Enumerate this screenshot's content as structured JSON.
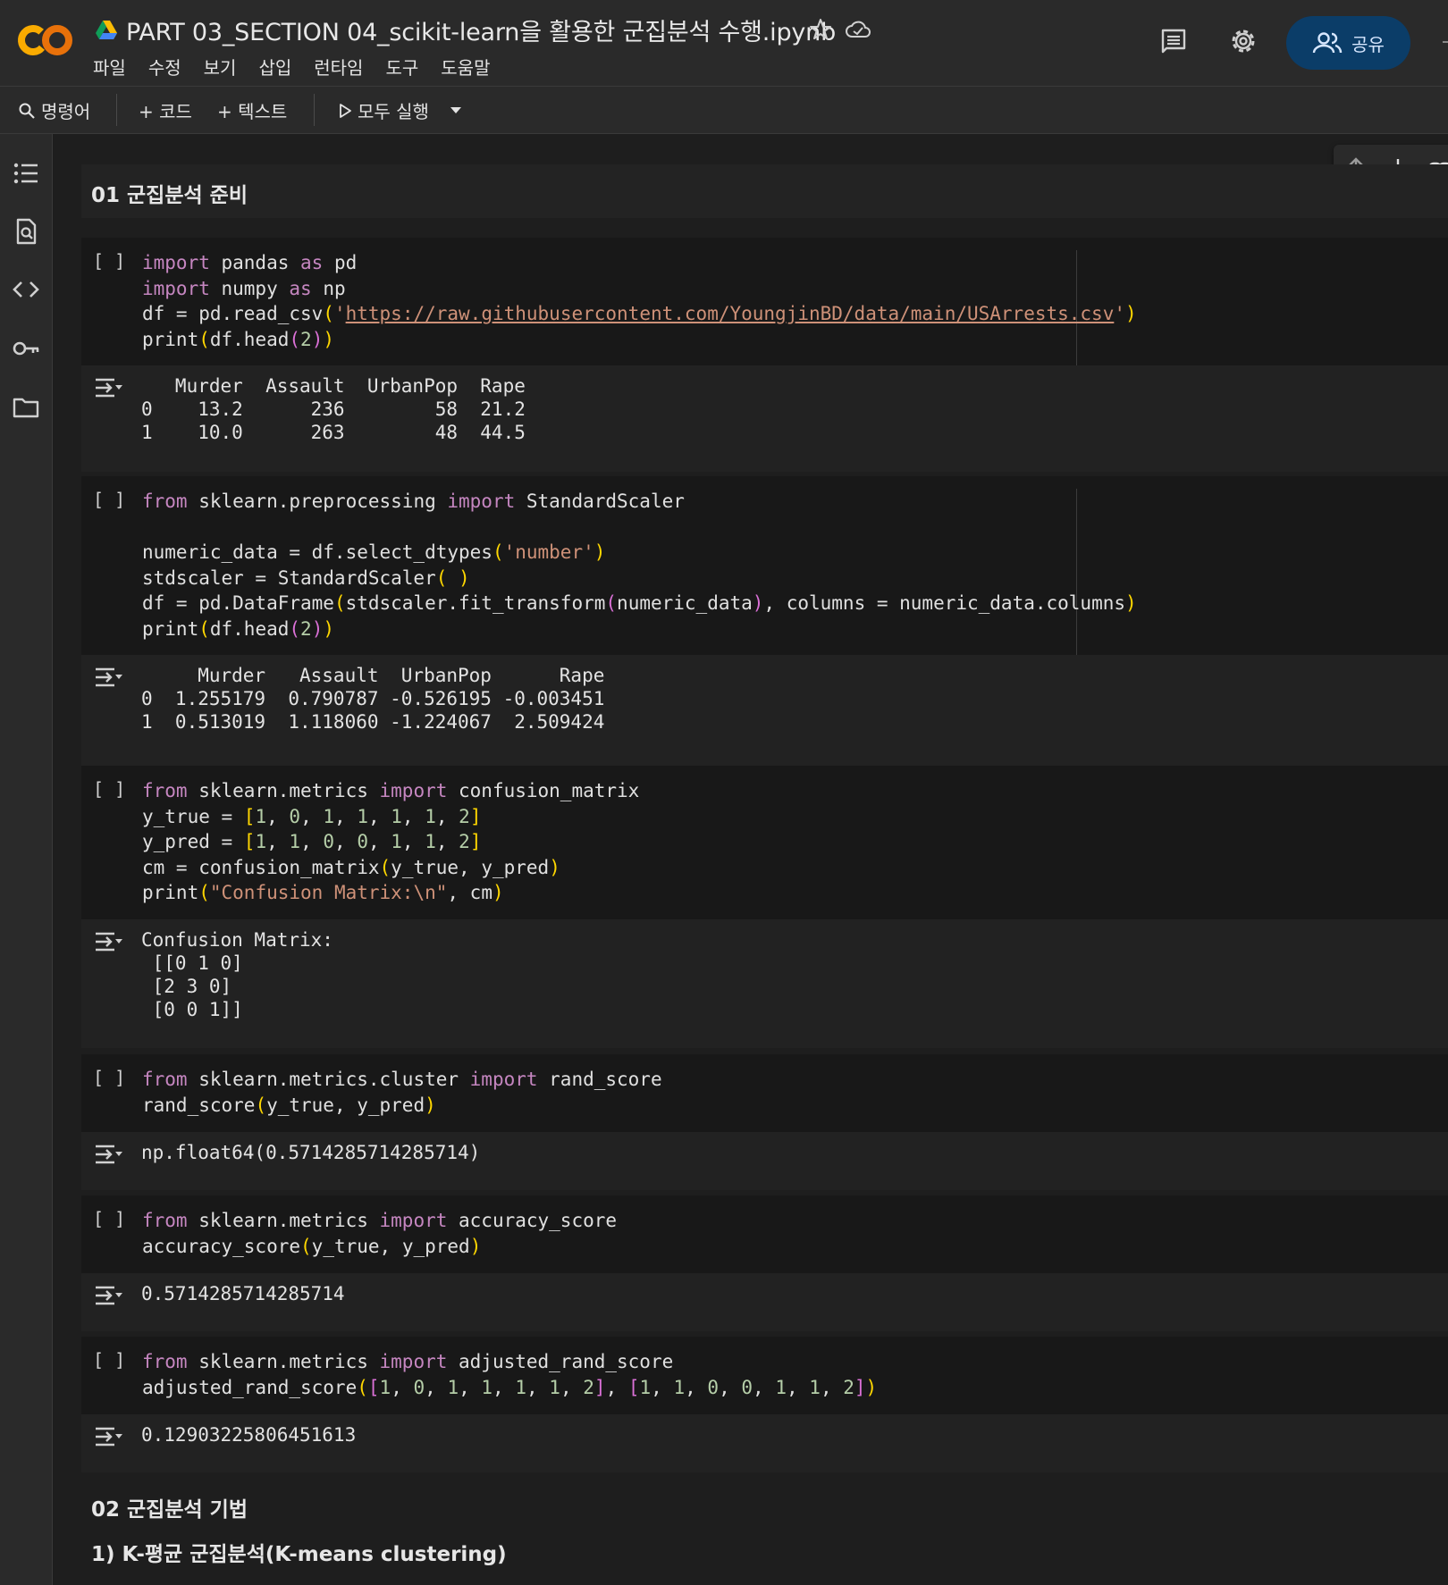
{
  "header": {
    "title": "PART 03_SECTION 04_scikit-learn을 활용한 군집분석 수행.ipynb",
    "share_label": "공유",
    "menu": [
      "파일",
      "수정",
      "보기",
      "삽입",
      "런타임",
      "도구",
      "도움말"
    ]
  },
  "toolbar": {
    "command_label": "명령어",
    "add_code_label": "+ 코드",
    "add_text_label": "+ 텍스트",
    "run_all_label": "모두 실행"
  },
  "left_rail": {
    "icons": [
      "toc-icon",
      "find-icon",
      "code-snippets-icon",
      "secrets-key-icon",
      "files-folder-icon"
    ]
  },
  "cell_toolbar": {
    "icons": [
      "move-up-icon",
      "move-down-icon",
      "link-icon",
      "comment-icon"
    ]
  },
  "notebook": {
    "heading_1": "01 군집분석 준비",
    "run_bracket": "[ ]",
    "cell1": {
      "code": [
        "import pandas as pd",
        "import numpy as np",
        "df = pd.read_csv('https://raw.githubusercontent.com/YoungjinBD/data/main/USArrests.csv')",
        "print(df.head(2))"
      ],
      "url": "https://raw.githubusercontent.com/YoungjinBD/data/main/USArrests.csv",
      "output": [
        "   Murder  Assault  UrbanPop  Rape",
        "0    13.2      236        58  21.2",
        "1    10.0      263        48  44.5"
      ]
    },
    "cell2": {
      "code": [
        "from sklearn.preprocessing import StandardScaler",
        "",
        "numeric_data = df.select_dtypes('number')",
        "stdscaler = StandardScaler( )",
        "df = pd.DataFrame(stdscaler.fit_transform(numeric_data), columns = numeric_data.columns)",
        "print(df.head(2))"
      ],
      "output": [
        "     Murder   Assault  UrbanPop      Rape",
        "0  1.255179  0.790787 -0.526195 -0.003451",
        "1  0.513019  1.118060 -1.224067  2.509424"
      ]
    },
    "cell3": {
      "code": [
        "from sklearn.metrics import confusion_matrix",
        "y_true = [1, 0, 1, 1, 1, 1, 2]",
        "y_pred = [1, 1, 0, 0, 1, 1, 2]",
        "cm = confusion_matrix(y_true, y_pred)",
        "print(\"Confusion Matrix:\\n\", cm)"
      ],
      "output": [
        "Confusion Matrix:",
        " [[0 1 0]",
        " [2 3 0]",
        " [0 0 1]]"
      ]
    },
    "cell4": {
      "code": [
        "from sklearn.metrics.cluster import rand_score",
        "rand_score(y_true, y_pred)"
      ],
      "output": [
        "np.float64(0.5714285714285714)"
      ]
    },
    "cell5": {
      "code": [
        "from sklearn.metrics import accuracy_score",
        "accuracy_score(y_true, y_pred)"
      ],
      "output": [
        "0.5714285714285714"
      ]
    },
    "cell6": {
      "code": [
        "from sklearn.metrics import adjusted_rand_score",
        "adjusted_rand_score([1, 0, 1, 1, 1, 1, 2], [1, 1, 0, 0, 1, 1, 2])"
      ],
      "output": [
        "0.12903225806451613"
      ]
    },
    "heading_2": "02 군집분석 기법",
    "heading_3": "1) K-평균 군집분석(K-means clustering)"
  },
  "colors": {
    "accent_share": "#0b3d68",
    "keyword": "#c586c0",
    "string": "#ce9178",
    "number": "#b5cea8",
    "paren_level1": "#ffd700",
    "paren_level2": "#da70d6",
    "logo_orange": "#f9ab00"
  }
}
